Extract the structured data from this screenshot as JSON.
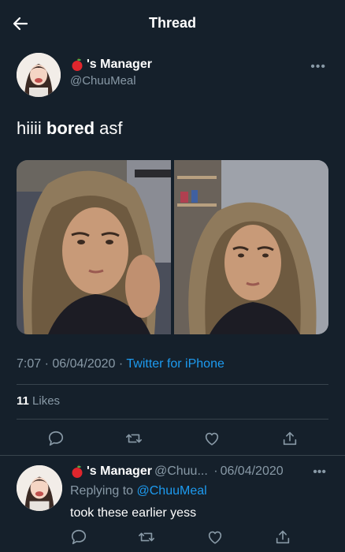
{
  "header": {
    "title": "Thread"
  },
  "tweet": {
    "author_name": "'s Manager",
    "handle": "@ChuuMeal",
    "text_start": "hiiii ",
    "text_bold": "bored",
    "text_end": " asf",
    "time": "7:07",
    "date": "06/04/2020",
    "source": "Twitter for iPhone",
    "likes_count": "11",
    "likes_label": "Likes",
    "more": "•••"
  },
  "reply": {
    "author_name": "'s Manager",
    "handle": "@Chuu...",
    "date": "06/04/2020",
    "replying_prefix": "Replying to",
    "replying_to": "@ChuuMeal",
    "text": "took these earlier yess",
    "more": "•••"
  },
  "colors": {
    "background": "#15202b",
    "accent": "#1d9bf0",
    "muted": "#8899a6",
    "divider": "#38444d"
  },
  "icons": [
    "back-arrow-icon",
    "apple-emoji-icon",
    "more-icon",
    "reply-icon",
    "retweet-icon",
    "like-icon",
    "share-icon"
  ]
}
